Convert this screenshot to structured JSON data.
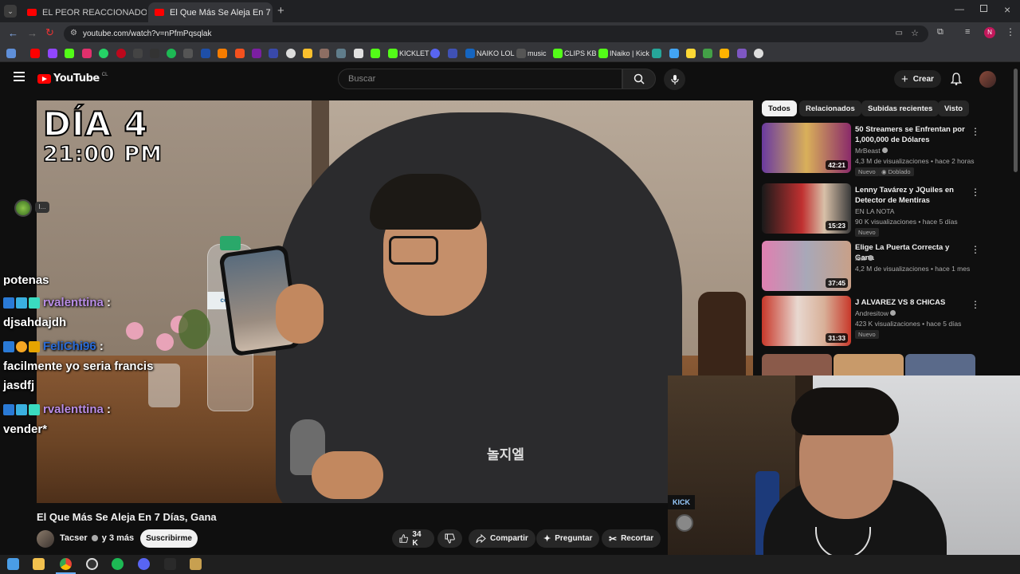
{
  "browser": {
    "tabs": [
      {
        "title": "EL PEOR REACCIONADOR DE T",
        "active": false
      },
      {
        "title": "El Que Más Se Aleja En 7 D",
        "active": true
      }
    ],
    "url": "youtube.com/watch?v=nPfmPqsqlak",
    "bookmarks": [
      "KICKLET",
      "NAIKO LOL",
      "music",
      "CLIPS KB",
      "INaiko | Kick"
    ]
  },
  "youtube": {
    "logo": "YouTube",
    "country": "CL",
    "search_placeholder": "Buscar",
    "create_label": "Crear",
    "avatar_letter": "N"
  },
  "video": {
    "overlay_day": "DÍA 4",
    "overlay_time": "21:00 PM",
    "bottle_label": "cesani",
    "title": "El Que Más Se Aleja En 7 Días, Gana",
    "channel": "Tacser",
    "channel_suffix": "y 3 más",
    "subscribe_label": "Suscribirme",
    "likes": "34 K",
    "share_label": "Compartir",
    "ask_label": "Preguntar",
    "clip_label": "Recortar"
  },
  "chat": [
    {
      "user": "",
      "message": "potenas"
    },
    {
      "user": "rvalenttina",
      "message": ""
    },
    {
      "user": "",
      "message": "djsahdajdh"
    },
    {
      "user": "FeliChi96",
      "message": ""
    },
    {
      "user": "",
      "message": "facilmente yo seria francis"
    },
    {
      "user": "",
      "message": "jasdfj"
    },
    {
      "user": "rvalenttina",
      "message": ""
    },
    {
      "user": "",
      "message": "vender*"
    }
  ],
  "sidebar": {
    "chips": [
      "Todos",
      "Relacionados",
      "Subidas recientes",
      "Visto"
    ],
    "recommendations": [
      {
        "title": "50 Streamers se Enfrentan por 1,000,000 de Dólares",
        "channel": "MrBeast",
        "meta": "4,3 M de visualizaciones • hace 2 horas",
        "badges": [
          "Nuevo",
          "Doblado"
        ],
        "duration": "42:21"
      },
      {
        "title": "Lenny Tavárez y JQuiles en Detector de Mentiras",
        "channel": "EN LA NOTA",
        "meta": "90 K visualizaciones • hace 5 días",
        "badges": [
          "Nuevo"
        ],
        "duration": "15:23"
      },
      {
        "title": "Elige La Puerta Correcta y Gana",
        "channel": "Ibai",
        "meta": "4,2 M de visualizaciones • hace 1 mes",
        "badges": [],
        "duration": "37:45"
      },
      {
        "title": "J ALVAREZ VS 8 CHICAS",
        "channel": "Andresitow",
        "meta": "423 K visualizaciones • hace 5 días",
        "badges": [
          "Nuevo"
        ],
        "duration": "31:33"
      }
    ]
  },
  "colors": {
    "youtube_red": "#ff0000",
    "chat_user_purple": "#b98de6",
    "chat_user_blue": "#2a6bd6"
  }
}
